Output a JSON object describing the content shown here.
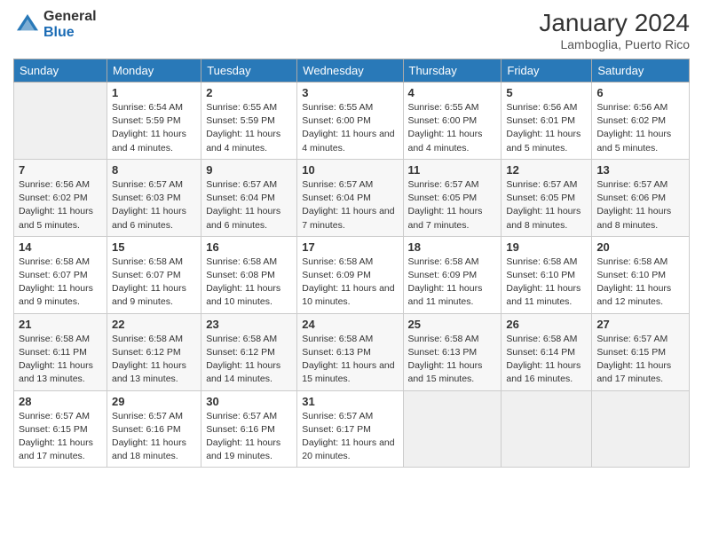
{
  "header": {
    "logo_general": "General",
    "logo_blue": "Blue",
    "month_title": "January 2024",
    "location": "Lamboglia, Puerto Rico"
  },
  "days_of_week": [
    "Sunday",
    "Monday",
    "Tuesday",
    "Wednesday",
    "Thursday",
    "Friday",
    "Saturday"
  ],
  "weeks": [
    [
      {
        "num": "",
        "sunrise": "",
        "sunset": "",
        "daylight": "",
        "empty": true
      },
      {
        "num": "1",
        "sunrise": "Sunrise: 6:54 AM",
        "sunset": "Sunset: 5:59 PM",
        "daylight": "Daylight: 11 hours and 4 minutes."
      },
      {
        "num": "2",
        "sunrise": "Sunrise: 6:55 AM",
        "sunset": "Sunset: 5:59 PM",
        "daylight": "Daylight: 11 hours and 4 minutes."
      },
      {
        "num": "3",
        "sunrise": "Sunrise: 6:55 AM",
        "sunset": "Sunset: 6:00 PM",
        "daylight": "Daylight: 11 hours and 4 minutes."
      },
      {
        "num": "4",
        "sunrise": "Sunrise: 6:55 AM",
        "sunset": "Sunset: 6:00 PM",
        "daylight": "Daylight: 11 hours and 4 minutes."
      },
      {
        "num": "5",
        "sunrise": "Sunrise: 6:56 AM",
        "sunset": "Sunset: 6:01 PM",
        "daylight": "Daylight: 11 hours and 5 minutes."
      },
      {
        "num": "6",
        "sunrise": "Sunrise: 6:56 AM",
        "sunset": "Sunset: 6:02 PM",
        "daylight": "Daylight: 11 hours and 5 minutes."
      }
    ],
    [
      {
        "num": "7",
        "sunrise": "Sunrise: 6:56 AM",
        "sunset": "Sunset: 6:02 PM",
        "daylight": "Daylight: 11 hours and 5 minutes."
      },
      {
        "num": "8",
        "sunrise": "Sunrise: 6:57 AM",
        "sunset": "Sunset: 6:03 PM",
        "daylight": "Daylight: 11 hours and 6 minutes."
      },
      {
        "num": "9",
        "sunrise": "Sunrise: 6:57 AM",
        "sunset": "Sunset: 6:04 PM",
        "daylight": "Daylight: 11 hours and 6 minutes."
      },
      {
        "num": "10",
        "sunrise": "Sunrise: 6:57 AM",
        "sunset": "Sunset: 6:04 PM",
        "daylight": "Daylight: 11 hours and 7 minutes."
      },
      {
        "num": "11",
        "sunrise": "Sunrise: 6:57 AM",
        "sunset": "Sunset: 6:05 PM",
        "daylight": "Daylight: 11 hours and 7 minutes."
      },
      {
        "num": "12",
        "sunrise": "Sunrise: 6:57 AM",
        "sunset": "Sunset: 6:05 PM",
        "daylight": "Daylight: 11 hours and 8 minutes."
      },
      {
        "num": "13",
        "sunrise": "Sunrise: 6:57 AM",
        "sunset": "Sunset: 6:06 PM",
        "daylight": "Daylight: 11 hours and 8 minutes."
      }
    ],
    [
      {
        "num": "14",
        "sunrise": "Sunrise: 6:58 AM",
        "sunset": "Sunset: 6:07 PM",
        "daylight": "Daylight: 11 hours and 9 minutes."
      },
      {
        "num": "15",
        "sunrise": "Sunrise: 6:58 AM",
        "sunset": "Sunset: 6:07 PM",
        "daylight": "Daylight: 11 hours and 9 minutes."
      },
      {
        "num": "16",
        "sunrise": "Sunrise: 6:58 AM",
        "sunset": "Sunset: 6:08 PM",
        "daylight": "Daylight: 11 hours and 10 minutes."
      },
      {
        "num": "17",
        "sunrise": "Sunrise: 6:58 AM",
        "sunset": "Sunset: 6:09 PM",
        "daylight": "Daylight: 11 hours and 10 minutes."
      },
      {
        "num": "18",
        "sunrise": "Sunrise: 6:58 AM",
        "sunset": "Sunset: 6:09 PM",
        "daylight": "Daylight: 11 hours and 11 minutes."
      },
      {
        "num": "19",
        "sunrise": "Sunrise: 6:58 AM",
        "sunset": "Sunset: 6:10 PM",
        "daylight": "Daylight: 11 hours and 11 minutes."
      },
      {
        "num": "20",
        "sunrise": "Sunrise: 6:58 AM",
        "sunset": "Sunset: 6:10 PM",
        "daylight": "Daylight: 11 hours and 12 minutes."
      }
    ],
    [
      {
        "num": "21",
        "sunrise": "Sunrise: 6:58 AM",
        "sunset": "Sunset: 6:11 PM",
        "daylight": "Daylight: 11 hours and 13 minutes."
      },
      {
        "num": "22",
        "sunrise": "Sunrise: 6:58 AM",
        "sunset": "Sunset: 6:12 PM",
        "daylight": "Daylight: 11 hours and 13 minutes."
      },
      {
        "num": "23",
        "sunrise": "Sunrise: 6:58 AM",
        "sunset": "Sunset: 6:12 PM",
        "daylight": "Daylight: 11 hours and 14 minutes."
      },
      {
        "num": "24",
        "sunrise": "Sunrise: 6:58 AM",
        "sunset": "Sunset: 6:13 PM",
        "daylight": "Daylight: 11 hours and 15 minutes."
      },
      {
        "num": "25",
        "sunrise": "Sunrise: 6:58 AM",
        "sunset": "Sunset: 6:13 PM",
        "daylight": "Daylight: 11 hours and 15 minutes."
      },
      {
        "num": "26",
        "sunrise": "Sunrise: 6:58 AM",
        "sunset": "Sunset: 6:14 PM",
        "daylight": "Daylight: 11 hours and 16 minutes."
      },
      {
        "num": "27",
        "sunrise": "Sunrise: 6:57 AM",
        "sunset": "Sunset: 6:15 PM",
        "daylight": "Daylight: 11 hours and 17 minutes."
      }
    ],
    [
      {
        "num": "28",
        "sunrise": "Sunrise: 6:57 AM",
        "sunset": "Sunset: 6:15 PM",
        "daylight": "Daylight: 11 hours and 17 minutes."
      },
      {
        "num": "29",
        "sunrise": "Sunrise: 6:57 AM",
        "sunset": "Sunset: 6:16 PM",
        "daylight": "Daylight: 11 hours and 18 minutes."
      },
      {
        "num": "30",
        "sunrise": "Sunrise: 6:57 AM",
        "sunset": "Sunset: 6:16 PM",
        "daylight": "Daylight: 11 hours and 19 minutes."
      },
      {
        "num": "31",
        "sunrise": "Sunrise: 6:57 AM",
        "sunset": "Sunset: 6:17 PM",
        "daylight": "Daylight: 11 hours and 20 minutes."
      },
      {
        "num": "",
        "sunrise": "",
        "sunset": "",
        "daylight": "",
        "empty": true
      },
      {
        "num": "",
        "sunrise": "",
        "sunset": "",
        "daylight": "",
        "empty": true
      },
      {
        "num": "",
        "sunrise": "",
        "sunset": "",
        "daylight": "",
        "empty": true
      }
    ]
  ]
}
